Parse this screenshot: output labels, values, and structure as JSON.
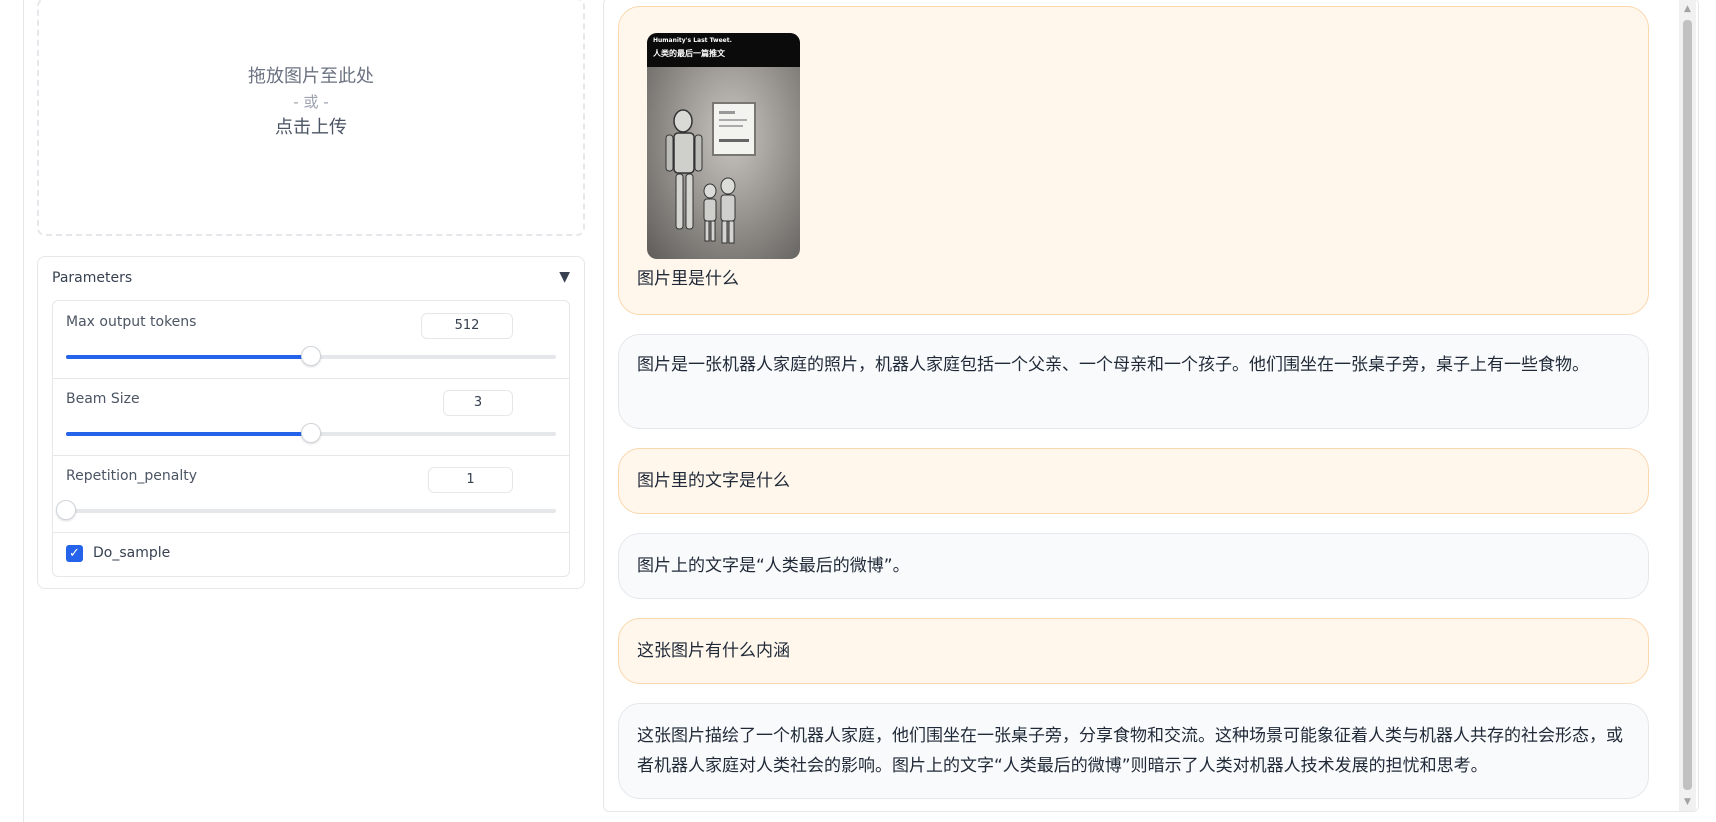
{
  "upload": {
    "line1": "拖放图片至此处",
    "line2": "- 或 -",
    "line3": "点击上传"
  },
  "parameters": {
    "title": "Parameters",
    "toggle_icon": "▼",
    "max_tokens": {
      "label": "Max output tokens",
      "value": "512",
      "fraction": 0.5
    },
    "beam_size": {
      "label": "Beam Size",
      "value": "3",
      "fraction": 0.5
    },
    "repetition_penalty": {
      "label": "Repetition_penalty",
      "value": "1",
      "fraction": 0.0
    },
    "do_sample": {
      "label": "Do_sample",
      "checked": true,
      "check_icon": "✓"
    }
  },
  "chat": {
    "image": {
      "caption_en": "Humanity's Last Tweet.",
      "caption_cn": "人类的最后一篇推文",
      "icon": "robot-family-photo"
    },
    "messages": [
      {
        "role": "user",
        "text": "图片里是什么"
      },
      {
        "role": "bot",
        "text": "图片是一张机器人家庭的照片，机器人家庭包括一个父亲、一个母亲和一个孩子。他们围坐在一张桌子旁，桌子上有一些食物。"
      },
      {
        "role": "user",
        "text": "图片里的文字是什么"
      },
      {
        "role": "bot",
        "text": "图片上的文字是“人类最后的微博”。"
      },
      {
        "role": "user",
        "text": "这张图片有什么内涵"
      },
      {
        "role": "bot",
        "text": "这张图片描绘了一个机器人家庭，他们围坐在一张桌子旁，分享食物和交流。这种场景可能象征着人类与机器人共存的社会形态，或者机器人家庭对人类社会的影响。图片上的文字“人类最后的微博”则暗示了人类对机器人技术发展的担忧和思考。"
      }
    ]
  },
  "scrollbar": {
    "up_icon": "▲",
    "down_icon": "▼"
  },
  "colors": {
    "accent": "#2563eb",
    "user_bubble": "#fff6ec",
    "user_border": "#fbd7ae",
    "bot_bubble": "#f9fafb"
  }
}
